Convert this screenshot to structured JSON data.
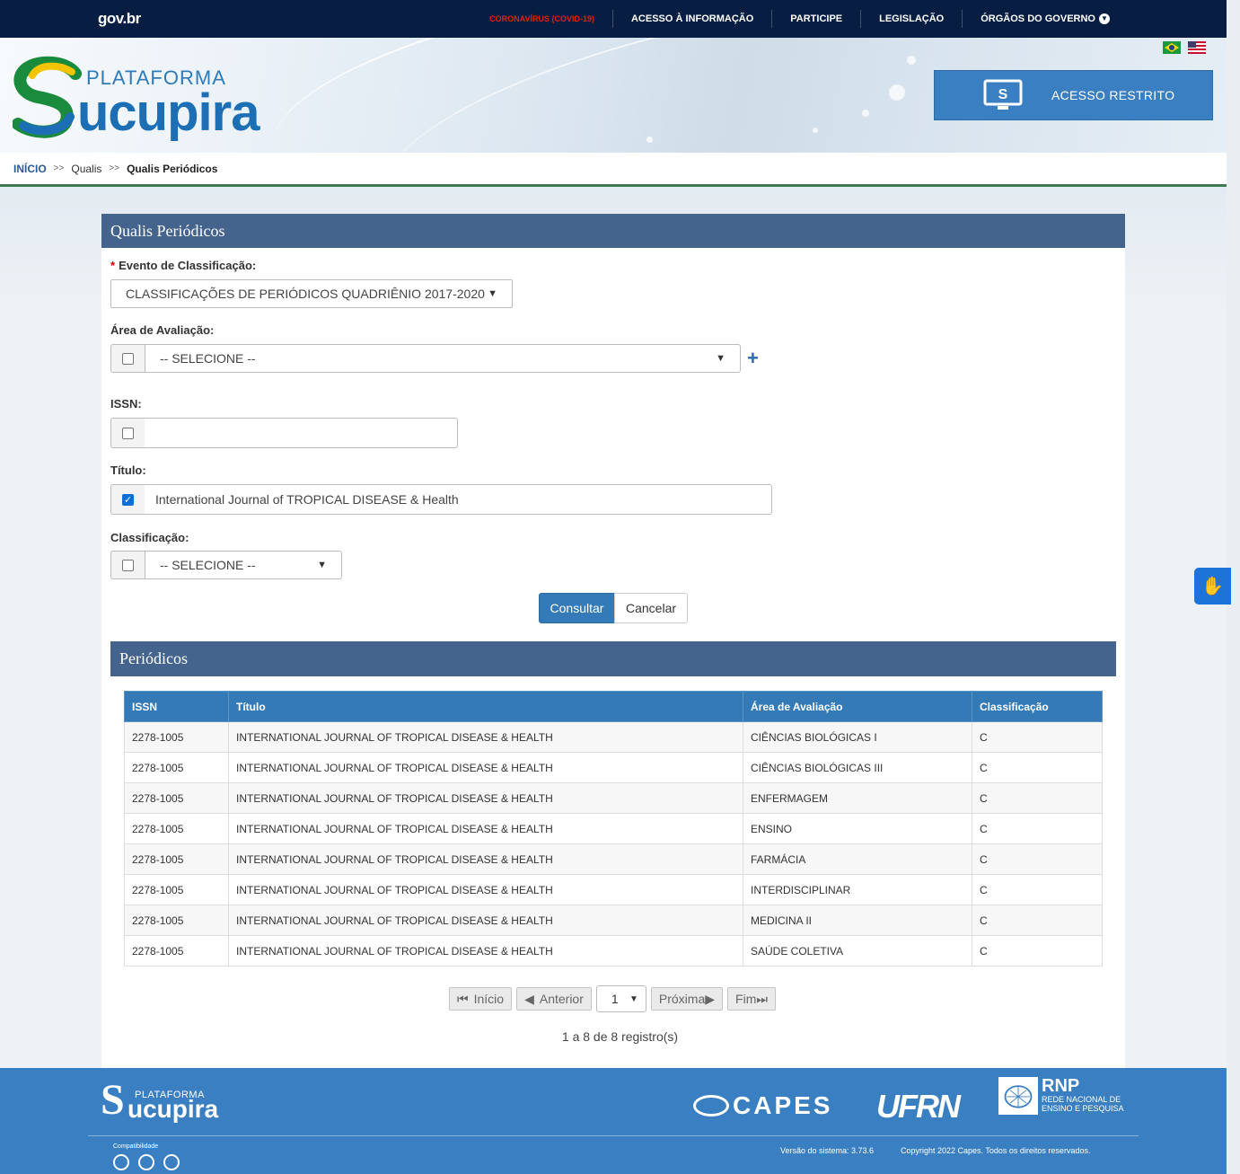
{
  "govbar": {
    "logo_gov": "gov",
    "logo_br": ".br",
    "nav": [
      "CORONAVÍRUS (COVID-19)",
      "ACESSO À INFORMAÇÃO",
      "PARTICIPE",
      "LEGISLAÇÃO",
      "ÓRGÃOS DO GOVERNO"
    ]
  },
  "header": {
    "logo_plat": "PLATAFORMA",
    "logo_main": "ucupira",
    "logo_s": "S",
    "acesso_label": "ACESSO RESTRITO"
  },
  "breadcrumb": {
    "home": "INÍCIO",
    "sep": ">>",
    "mid": "Qualis",
    "current": "Qualis Periódicos"
  },
  "form": {
    "title": "Qualis Periódicos",
    "evento_label": "Evento de Classificação:",
    "evento_value": "CLASSIFICAÇÕES DE PERIÓDICOS QUADRIÊNIO 2017-2020",
    "area_label": "Área de Avaliação:",
    "area_value": "-- SELECIONE --",
    "issn_label": "ISSN:",
    "issn_value": "",
    "titulo_label": "Título:",
    "titulo_value": "International Journal of TROPICAL DISEASE & Health",
    "classif_label": "Classificação:",
    "classif_value": "-- SELECIONE --",
    "consultar": "Consultar",
    "cancelar": "Cancelar"
  },
  "results": {
    "title": "Periódicos",
    "columns": [
      "ISSN",
      "Título",
      "Área de Avaliação",
      "Classificação"
    ],
    "rows": [
      [
        "2278-1005",
        "INTERNATIONAL JOURNAL OF TROPICAL DISEASE & HEALTH",
        "CIÊNCIAS BIOLÓGICAS I",
        "C"
      ],
      [
        "2278-1005",
        "INTERNATIONAL JOURNAL OF TROPICAL DISEASE & HEALTH",
        "CIÊNCIAS BIOLÓGICAS III",
        "C"
      ],
      [
        "2278-1005",
        "INTERNATIONAL JOURNAL OF TROPICAL DISEASE & HEALTH",
        "ENFERMAGEM",
        "C"
      ],
      [
        "2278-1005",
        "INTERNATIONAL JOURNAL OF TROPICAL DISEASE & HEALTH",
        "ENSINO",
        "C"
      ],
      [
        "2278-1005",
        "INTERNATIONAL JOURNAL OF TROPICAL DISEASE & HEALTH",
        "FARMÁCIA",
        "C"
      ],
      [
        "2278-1005",
        "INTERNATIONAL JOURNAL OF TROPICAL DISEASE & HEALTH",
        "INTERDISCIPLINAR",
        "C"
      ],
      [
        "2278-1005",
        "INTERNATIONAL JOURNAL OF TROPICAL DISEASE & HEALTH",
        "MEDICINA II",
        "C"
      ],
      [
        "2278-1005",
        "INTERNATIONAL JOURNAL OF TROPICAL DISEASE & HEALTH",
        "SAÚDE COLETIVA",
        "C"
      ]
    ]
  },
  "pager": {
    "inicio": "Início",
    "anterior": "Anterior",
    "page": "1",
    "proxima": "Próxima",
    "fim": "Fim",
    "registros": "1 a 8 de 8 registro(s)"
  },
  "footer": {
    "logo_plat": "PLATAFORMA",
    "logo_main": "ucupira",
    "logo_s": "S",
    "capes": "CAPES",
    "ufrn": "UFRN",
    "rnp": "RNP",
    "rnp_line1": "REDE NACIONAL DE",
    "rnp_line2": "ENSINO E PESQUISA",
    "compat": "Compatibilidade",
    "versao": "Versão do sistema: 3.73.6",
    "copyright": "Copyright 2022 Capes. Todos os direitos reservados."
  },
  "colors": {
    "govbar": "#071d41",
    "panel_head": "#44638d",
    "primary": "#337ab7",
    "footer": "#3a7fc1"
  }
}
